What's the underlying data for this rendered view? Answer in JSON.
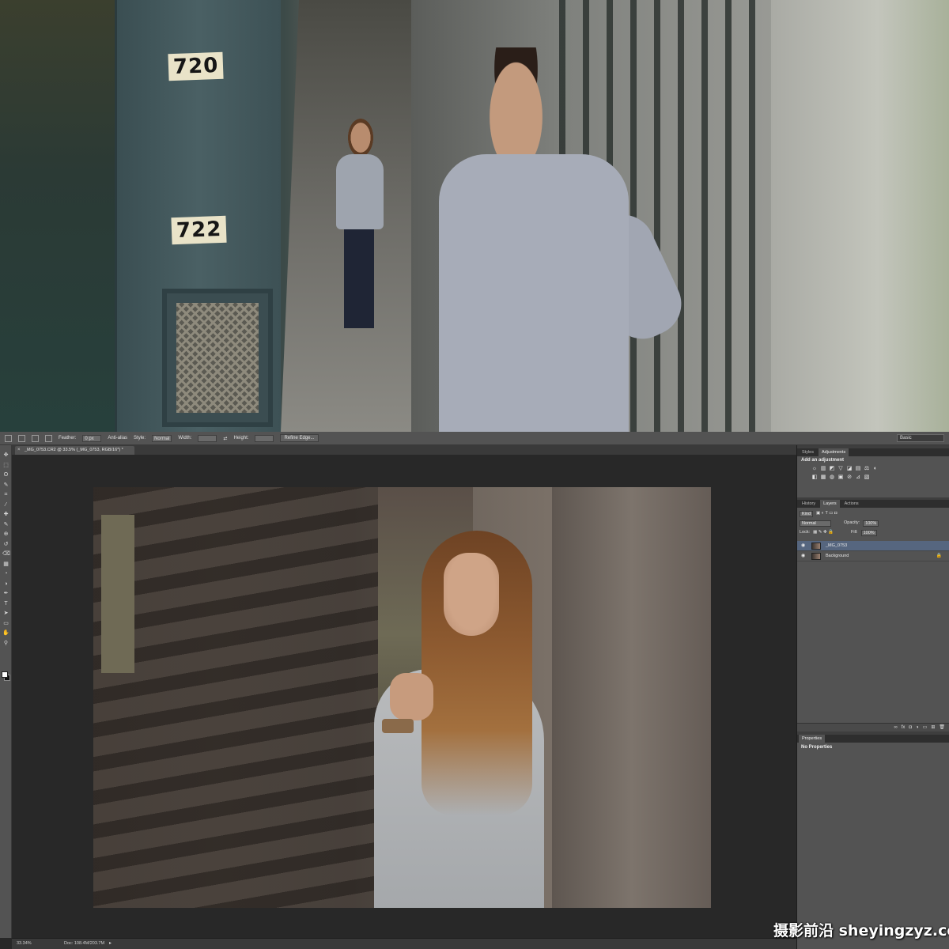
{
  "photo": {
    "house_numbers": [
      "720",
      "722"
    ]
  },
  "options_bar": {
    "feather_label": "Feather:",
    "feather_value": "0 px",
    "antialias_label": "Anti-alias",
    "style_label": "Style:",
    "style_value": "Normal",
    "width_label": "Width:",
    "height_label": "Height:",
    "refine_edge_label": "Refine Edge...",
    "workspace": "Basic"
  },
  "document": {
    "tab_title": "_MG_0753.CR2 @ 33.5% (_MG_0753, RGB/16*) *",
    "close_glyph": "×"
  },
  "toolbar": {
    "tools": [
      "move-icon",
      "marquee-icon",
      "lasso-icon",
      "quick-select-icon",
      "crop-icon",
      "eyedropper-icon",
      "healing-icon",
      "brush-icon",
      "clone-stamp-icon",
      "history-brush-icon",
      "eraser-icon",
      "gradient-icon",
      "blur-icon",
      "dodge-icon",
      "pen-icon",
      "type-icon",
      "path-select-icon",
      "shape-icon",
      "hand-icon",
      "zoom-icon"
    ],
    "glyphs": [
      "✥",
      "⬚",
      "ʘ",
      "✎",
      "⌗",
      "⁄",
      "✚",
      "✎",
      "⊕",
      "↺",
      "⌫",
      "▦",
      "◔",
      "◑",
      "✒",
      "T",
      "➤",
      "▭",
      "✋",
      "⚲"
    ]
  },
  "status": {
    "zoom": "33.34%",
    "doc_size": "Doc: 108.4M/203.7M",
    "arrow": "▸"
  },
  "panels": {
    "top_tabs": [
      "Styles",
      "Adjustments"
    ],
    "adjustments_title": "Add an adjustment",
    "adjustment_glyphs": [
      "☼",
      "▥",
      "◩",
      "▽",
      "◪",
      "▤",
      "⚖",
      "◐",
      "◧",
      "▦",
      "◍",
      "▣",
      "⊘",
      "⊿",
      "▧"
    ],
    "layers_tabs": [
      "History",
      "Layers",
      "Actions"
    ],
    "kind_label": "Kind",
    "blend_mode": "Normal",
    "opacity_label": "Opacity:",
    "opacity_value": "100%",
    "lock_label": "Lock:",
    "fill_label": "Fill:",
    "fill_value": "100%",
    "layers": [
      {
        "name": "_MG_0753",
        "selected": true
      },
      {
        "name": "Background",
        "selected": false
      }
    ],
    "eye_glyph": "◉",
    "lock_glyph": "🔒",
    "footer_glyphs": [
      "∞",
      "fx",
      "◘",
      "◑",
      "▭",
      "⊞",
      "🗑"
    ],
    "properties_tab": "Properties",
    "properties_text": "No Properties"
  },
  "watermark": "摄影前沿 sheyingzyz.com"
}
